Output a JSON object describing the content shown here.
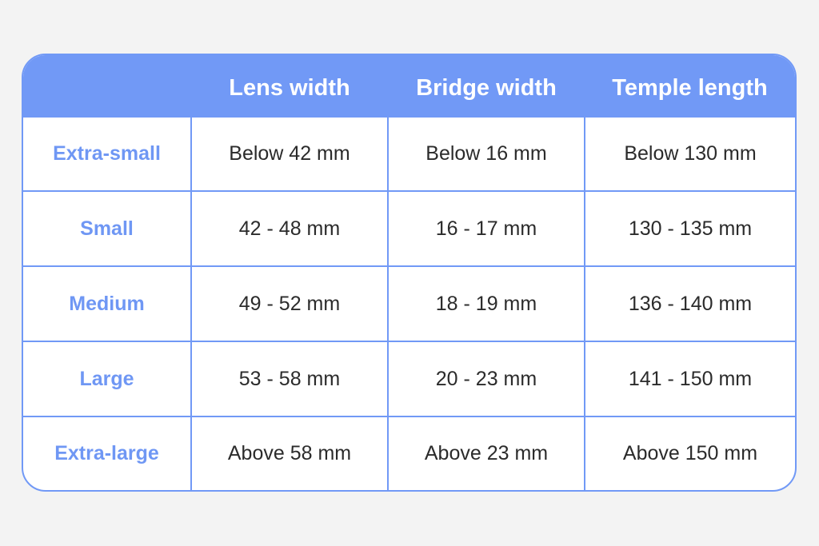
{
  "table": {
    "columns": [
      "",
      "Lens width",
      "Bridge width",
      "Temple length"
    ],
    "rows": [
      {
        "size": "Extra-small",
        "lens": "Below 42 mm",
        "bridge": "Below 16 mm",
        "temple": "Below 130 mm"
      },
      {
        "size": "Small",
        "lens": "42 - 48 mm",
        "bridge": "16 - 17 mm",
        "temple": "130 - 135 mm"
      },
      {
        "size": "Medium",
        "lens": "49 - 52 mm",
        "bridge": "18 - 19 mm",
        "temple": "136 - 140 mm"
      },
      {
        "size": "Large",
        "lens": "53 - 58 mm",
        "bridge": "20 - 23 mm",
        "temple": "141 - 150 mm"
      },
      {
        "size": "Extra-large",
        "lens": "Above 58 mm",
        "bridge": "Above 23 mm",
        "temple": "Above 150 mm"
      }
    ]
  },
  "colors": {
    "accent": "#7199f6",
    "background": "#f3f3f3",
    "text": "#2b2b2b"
  }
}
